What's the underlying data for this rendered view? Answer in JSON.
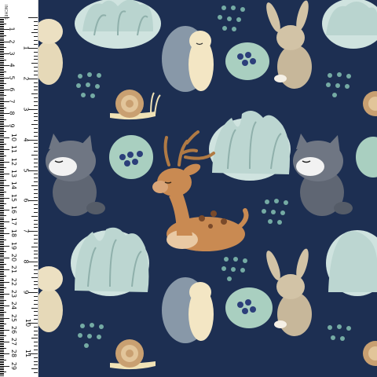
{
  "ruler": {
    "title": "INCHES",
    "cm_labels": [
      "1",
      "2",
      "3",
      "4",
      "5",
      "6",
      "7",
      "8",
      "9",
      "10",
      "11",
      "12",
      "13",
      "14",
      "15",
      "16",
      "17",
      "18",
      "19",
      "20",
      "21",
      "22",
      "23",
      "24",
      "25",
      "26",
      "27",
      "28",
      "29",
      "30"
    ],
    "in_labels": [
      "1",
      "2",
      "3",
      "4",
      "5",
      "6",
      "7",
      "8",
      "9",
      "10",
      "11",
      "12"
    ]
  },
  "colors": {
    "background": "#1d2f52",
    "foliage": "#cfe3df",
    "deer": "#c98a52",
    "berries": "#2c3f7a",
    "dots": "#7fb9ad"
  },
  "motifs": [
    "deer",
    "wolf",
    "wolf",
    "hedgehog",
    "hedgehog",
    "rabbit",
    "rabbit",
    "snail",
    "snail",
    "leaf-bush",
    "berry-bush",
    "dot-cluster"
  ]
}
